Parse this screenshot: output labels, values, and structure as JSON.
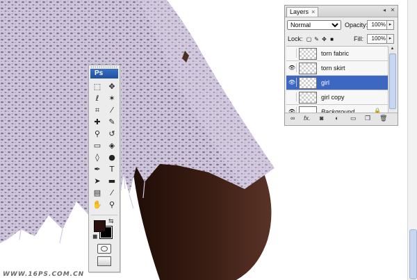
{
  "watermark": "WWW.16PS.COM.CN",
  "tools_palette": {
    "logo": "Ps",
    "tools": [
      {
        "name": "marquee-tool-icon",
        "glyph": "⬚"
      },
      {
        "name": "move-tool-icon",
        "glyph": "✥"
      },
      {
        "name": "lasso-tool-icon",
        "glyph": "ℓ"
      },
      {
        "name": "magic-wand-tool-icon",
        "glyph": "✶"
      },
      {
        "name": "crop-tool-icon",
        "glyph": "⌗"
      },
      {
        "name": "slice-tool-icon",
        "glyph": "⁄"
      },
      {
        "name": "healing-brush-tool-icon",
        "glyph": "✚"
      },
      {
        "name": "brush-tool-icon",
        "glyph": "✎"
      },
      {
        "name": "clone-stamp-tool-icon",
        "glyph": "⚲"
      },
      {
        "name": "history-brush-tool-icon",
        "glyph": "↺"
      },
      {
        "name": "eraser-tool-icon",
        "glyph": "▭"
      },
      {
        "name": "paint-bucket-tool-icon",
        "glyph": "◈"
      },
      {
        "name": "blur-tool-icon",
        "glyph": "◊"
      },
      {
        "name": "dodge-tool-icon",
        "glyph": "●"
      },
      {
        "name": "pen-tool-icon",
        "glyph": "✒"
      },
      {
        "name": "type-tool-icon",
        "glyph": "T"
      },
      {
        "name": "path-selection-tool-icon",
        "glyph": "➤"
      },
      {
        "name": "shape-tool-icon",
        "glyph": "▬"
      },
      {
        "name": "notes-tool-icon",
        "glyph": "▤"
      },
      {
        "name": "eyedropper-tool-icon",
        "glyph": "⁄"
      },
      {
        "name": "hand-tool-icon",
        "glyph": "✋"
      },
      {
        "name": "zoom-tool-icon",
        "glyph": "⚲"
      }
    ],
    "colors": {
      "foreground": "#2a120c",
      "background": "#000000"
    }
  },
  "layers_panel": {
    "tab_label": "Layers",
    "tab_close": "×",
    "blend_mode": "Normal",
    "opacity_label": "Opacity:",
    "opacity_value": "100%",
    "lock_label": "Lock:",
    "fill_label": "Fill:",
    "fill_value": "100%",
    "layers": [
      {
        "name": "torn fabric",
        "visible": false,
        "selected": false,
        "thumb": "transparent",
        "italic": false
      },
      {
        "name": "torn skirt",
        "visible": true,
        "selected": false,
        "thumb": "transparent",
        "italic": false
      },
      {
        "name": "girl",
        "visible": true,
        "selected": true,
        "thumb": "transparent",
        "italic": false
      },
      {
        "name": "girl copy",
        "visible": false,
        "selected": false,
        "thumb": "transparent",
        "italic": false
      },
      {
        "name": "Background",
        "visible": true,
        "selected": false,
        "thumb": "white",
        "italic": true,
        "locked": true
      }
    ],
    "bottom_icons": [
      "link-layers-icon",
      "fx-icon",
      "add-mask-icon",
      "adjustment-layer-icon",
      "new-group-icon",
      "new-layer-icon",
      "delete-layer-icon"
    ]
  },
  "accent_colors": {
    "selection": "#3c68c4",
    "lace": "#cfc6dc",
    "skin": "#3a1d13"
  }
}
